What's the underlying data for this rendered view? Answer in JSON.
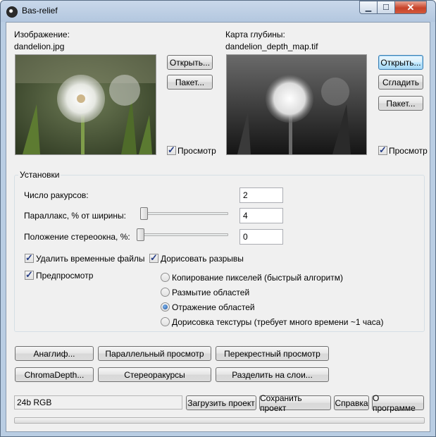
{
  "window": {
    "title": "Bas-relief",
    "min_icon": "minimize-icon",
    "max_icon": "maximize-icon",
    "close_icon": "close-icon"
  },
  "image": {
    "label": "Изображение:",
    "filename": "dandelion.jpg",
    "open_button": "Открыть...",
    "batch_button": "Пакет...",
    "preview_label": "Просмотр",
    "preview_checked": true
  },
  "depth": {
    "label": "Карта глубины:",
    "filename": "dandelion_depth_map.tif",
    "open_button": "Открыть...",
    "smooth_button": "Сгладить",
    "batch_button": "Пакет...",
    "preview_label": "Просмотр",
    "preview_checked": true
  },
  "settings": {
    "title": "Установки",
    "views_label": "Число ракурсов:",
    "views_value": "2",
    "parallax_label": "Параллакс, % от ширины:",
    "parallax_value": "4",
    "window_label": "Положение стереоокна, %:",
    "window_value": "0",
    "delete_temp_label": "Удалить временные файлы",
    "delete_temp_checked": true,
    "fill_gaps_label": "Дорисовать разрывы",
    "fill_gaps_checked": true,
    "preview_label": "Предпросмотр",
    "preview_checked": true,
    "methods": [
      {
        "label": "Копирование пикселей (быстрый алгоритм)",
        "selected": false
      },
      {
        "label": "Размытие областей",
        "selected": false
      },
      {
        "label": "Отражение областей",
        "selected": true
      },
      {
        "label": "Дорисовка текстуры (требует много времени ~1 часа)",
        "selected": false
      }
    ]
  },
  "actions": {
    "anaglyph": "Анаглиф...",
    "parallel": "Параллельный просмотр",
    "cross": "Перекрестный просмотр",
    "chromadepth": "ChromaDepth...",
    "stereo_views": "Стереоракурсы",
    "split_layers": "Разделить на слои..."
  },
  "footer": {
    "status": "24b RGB",
    "load_project": "Загрузить проект",
    "save_project": "Сохранить проект",
    "help": "Справка",
    "about": "О программе",
    "progress": 0
  }
}
